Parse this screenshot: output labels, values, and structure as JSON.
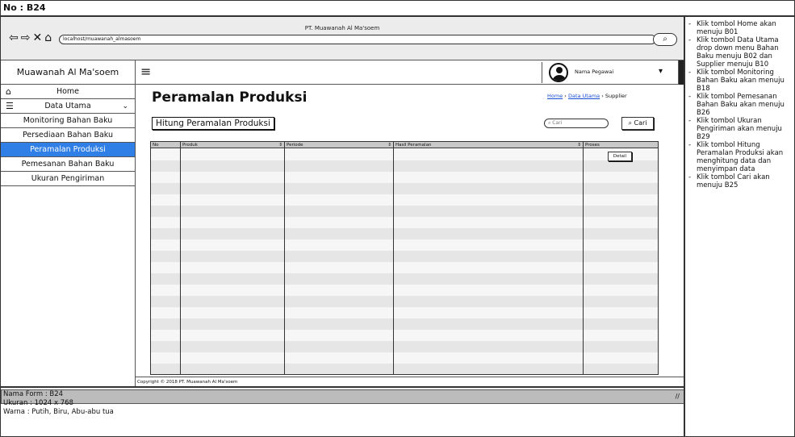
{
  "top": {
    "no": "No : B24"
  },
  "browser": {
    "title": "PT. Muawanah Al Ma'soem",
    "url": "localhost/muawanah_almasoem",
    "nav_icons": [
      "back-icon",
      "forward-icon",
      "close-icon",
      "home-icon"
    ]
  },
  "sidebar": {
    "brand": "Muawanah Al Ma'soem",
    "items": [
      {
        "label": "Home",
        "icon": "home-icon"
      },
      {
        "label": "Data Utama",
        "icon": "database-icon"
      },
      {
        "label": "Monitoring Bahan Baku"
      },
      {
        "label": "Persediaan Bahan Baku"
      },
      {
        "label": "Peramalan Produksi"
      },
      {
        "label": "Pemesanan Bahan Baku"
      },
      {
        "label": "Ukuran Pengiriman"
      }
    ]
  },
  "header": {
    "user_name": "Nama Pegawai"
  },
  "main": {
    "title": "Peramalan Produksi",
    "breadcrumb": {
      "home": "Home",
      "data_utama": "Data Utama",
      "current": "Supplier"
    },
    "hitung_button": "Hitung Peramalan Produksi",
    "search_placeholder": "Cari",
    "search_button": "Cari",
    "table": {
      "columns": [
        "No",
        "Produk",
        "Periode",
        "Hasil Peramalan",
        "Proses"
      ],
      "detail_button": "Detail"
    },
    "footer": "Copyright © 2018 PT. Muawanah Al Ma'soem"
  },
  "meta": {
    "line1": "Nama Form : B24",
    "line2": "Ukuran : 1024 x 768",
    "line3": "Warna : Putih, Biru, Abu-abu tua"
  },
  "notes": [
    "Klik tombol Home akan menuju B01",
    "Klik tombol Data Utama drop down menu Bahan Baku menuju B02 dan Supplier menuju B10",
    "Klik tombol Monitoring Bahan Baku akan menuju B18",
    "Klik tombol Pemesanan Bahan Baku akan menuju B26",
    "Klik tombol Ukuran Pengiriman akan menuju B29",
    "Klik tombol Hitung Peramalan Produksi akan menghitung data dan menyimpan data",
    "Klik tombol Cari akan menuju B25"
  ],
  "colors": {
    "active": "#2f7fe6",
    "header_gray": "#c9c9c9",
    "bar_gray": "#bcbcbc"
  }
}
